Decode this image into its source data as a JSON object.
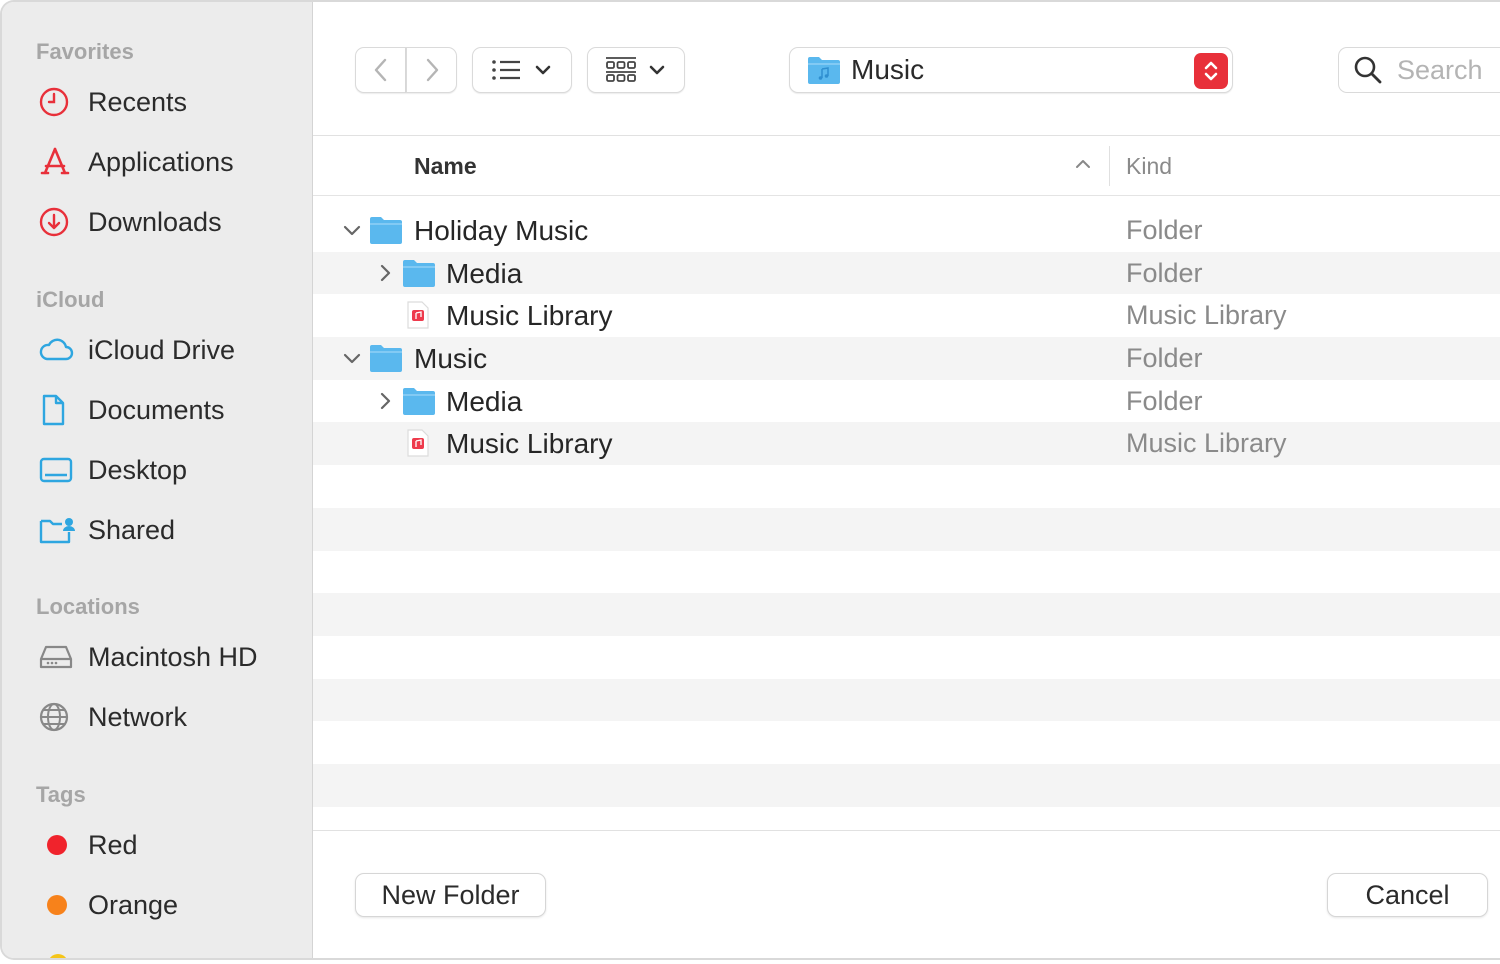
{
  "sidebar": {
    "sections": {
      "favorites": "Favorites",
      "icloud": "iCloud",
      "locations": "Locations",
      "tags": "Tags"
    },
    "favorites": [
      {
        "label": "Recents",
        "icon": "clock-icon"
      },
      {
        "label": "Applications",
        "icon": "applications-icon"
      },
      {
        "label": "Downloads",
        "icon": "download-icon"
      }
    ],
    "icloud": [
      {
        "label": "iCloud Drive",
        "icon": "cloud-icon"
      },
      {
        "label": "Documents",
        "icon": "document-icon"
      },
      {
        "label": "Desktop",
        "icon": "desktop-icon"
      },
      {
        "label": "Shared",
        "icon": "shared-folder-icon"
      }
    ],
    "locations": [
      {
        "label": "Macintosh HD",
        "icon": "hard-drive-icon"
      },
      {
        "label": "Network",
        "icon": "globe-icon"
      }
    ],
    "tags": [
      {
        "label": "Red",
        "color": "#f0232c"
      },
      {
        "label": "Orange",
        "color": "#f7821b"
      }
    ]
  },
  "toolbar": {
    "location": "Music",
    "search_placeholder": "Search"
  },
  "columns": {
    "name": "Name",
    "kind": "Kind"
  },
  "rows": [
    {
      "name": "Holiday Music",
      "kind": "Folder",
      "type": "folder",
      "expanded": true,
      "level": 0
    },
    {
      "name": "Media",
      "kind": "Folder",
      "type": "folder",
      "expanded": false,
      "level": 1
    },
    {
      "name": "Music Library",
      "kind": "Music Library",
      "type": "music-library",
      "level": 1
    },
    {
      "name": "Music",
      "kind": "Folder",
      "type": "folder",
      "expanded": true,
      "level": 0
    },
    {
      "name": "Media",
      "kind": "Folder",
      "type": "folder",
      "expanded": false,
      "level": 1
    },
    {
      "name": "Music Library",
      "kind": "Music Library",
      "type": "music-library",
      "level": 1
    }
  ],
  "footer": {
    "new_folder": "New Folder",
    "cancel": "Cancel"
  },
  "colors": {
    "accent_red": "#e8303a",
    "folder_blue": "#5ab8ee",
    "sidebar_icon_red": "#e8303a",
    "sidebar_icon_blue": "#2ea6e0"
  }
}
